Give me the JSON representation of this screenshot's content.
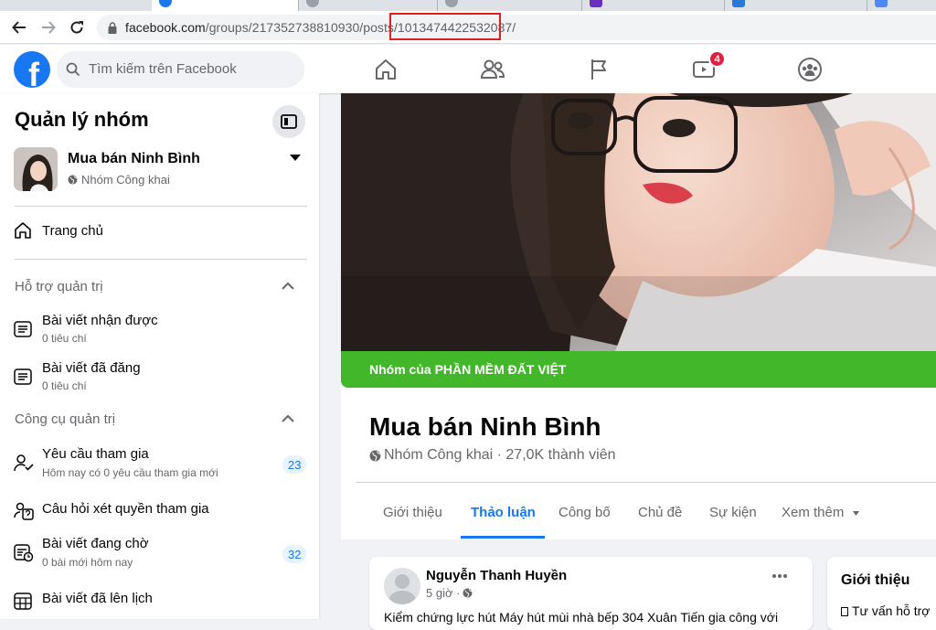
{
  "browser": {
    "url_host": "facebook.com",
    "url_path": "/groups/217352738810930/posts/",
    "url_highlight": "1013474422532087/",
    "highlight_color": "#e02020"
  },
  "fb": {
    "logo_letter": "f",
    "search_placeholder": "Tìm kiếm trên Facebook",
    "notif_count": "4",
    "brand_color": "#1877f2"
  },
  "sidebar": {
    "title": "Quản lý nhóm",
    "group_name": "Mua bán Ninh Bình",
    "group_privacy": "Nhóm Công khai",
    "home_label": "Trang chủ",
    "section_admin_support": "Hỗ trợ quản trị",
    "items_support": [
      {
        "label": "Bài viết nhận được",
        "sub": "0 tiêu chí"
      },
      {
        "label": "Bài viết đã đăng",
        "sub": "0 tiêu chí"
      }
    ],
    "section_admin_tools": "Công cụ quản trị",
    "items_tools": [
      {
        "label": "Yêu cầu tham gia",
        "sub": "Hôm nay có 0 yêu cầu tham gia mới",
        "count": "23"
      },
      {
        "label": "Câu hỏi xét quyền tham gia"
      },
      {
        "label": "Bài viết đang chờ",
        "sub": "0 bài mới hôm nay",
        "count": "32"
      },
      {
        "label": "Bài viết đã lên lịch"
      }
    ]
  },
  "group": {
    "banner_text": "Nhóm của PHẦN MỀM ĐẤT VIỆT",
    "banner_color": "#42b72a",
    "name": "Mua bán Ninh Bình",
    "meta": "Nhóm Công khai · 27,0K thành viên",
    "tabs": [
      {
        "label": "Giới thiệu"
      },
      {
        "label": "Thảo luận",
        "active": true
      },
      {
        "label": "Công bố"
      },
      {
        "label": "Chủ đề"
      },
      {
        "label": "Sự kiện"
      },
      {
        "label": "Xem thêm"
      }
    ]
  },
  "post": {
    "author": "Nguyễn Thanh Huyền",
    "time": "5 giờ ·",
    "text": "Kiểm chứng lực hút Máy hút mùi nhà bếp 304 Xuân Tiến gia công với"
  },
  "about": {
    "heading": "Giới thiệu",
    "text": "Tư vấn hỗ trợ"
  }
}
